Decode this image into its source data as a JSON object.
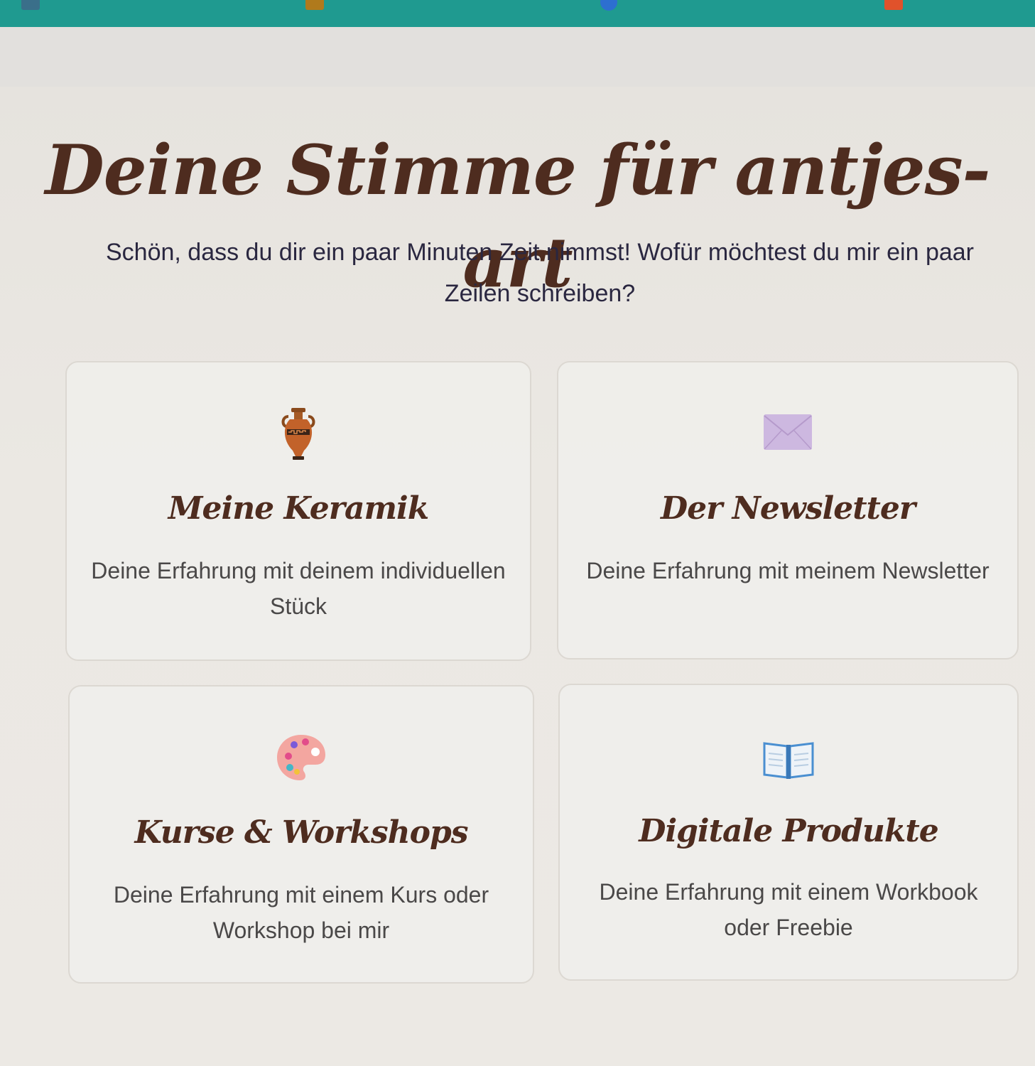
{
  "page": {
    "title": "Deine Stimme für antjes-art",
    "intro": "Schön, dass du dir ein paar Minuten Zeit nimmst! Wofür möchtest du mir ein paar Zeilen schreiben?"
  },
  "cards": [
    {
      "title": "Meine Keramik",
      "description": "Deine Erfahrung mit deinem individuellen Stück",
      "icon": "amphora-icon"
    },
    {
      "title": "Der Newsletter",
      "description": "Deine Erfahrung mit meinem Newsletter",
      "icon": "envelope-icon"
    },
    {
      "title": "Kurse & Workshops",
      "description": "Deine Erfahrung mit einem Kurs oder Workshop bei mir",
      "icon": "palette-icon"
    },
    {
      "title": "Digitale Produkte",
      "description": "Deine Erfahrung mit einem Workbook oder Freebie",
      "icon": "open-book-icon"
    }
  ],
  "colors": {
    "browser_bar": "#1f9a90",
    "heading": "#4e2c1f",
    "intro_text": "#2a2740",
    "card_text": "#4a4848"
  }
}
